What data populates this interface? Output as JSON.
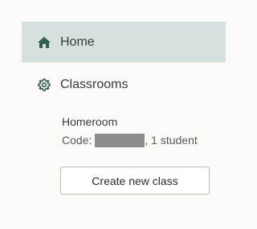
{
  "colors": {
    "background": "#fbfaf6",
    "active_nav_bg": "#d5e1df",
    "icon": "#355c52",
    "redaction": "#8c8c8c"
  },
  "nav": {
    "items": [
      {
        "label": "Home",
        "icon": "home-icon",
        "active": true
      },
      {
        "label": "Classrooms",
        "icon": "gear-icon",
        "active": false
      }
    ]
  },
  "classroom": {
    "name": "Homeroom",
    "code_prefix": "Code:",
    "student_count": ", 1 student"
  },
  "actions": {
    "create_label": "Create new class"
  }
}
